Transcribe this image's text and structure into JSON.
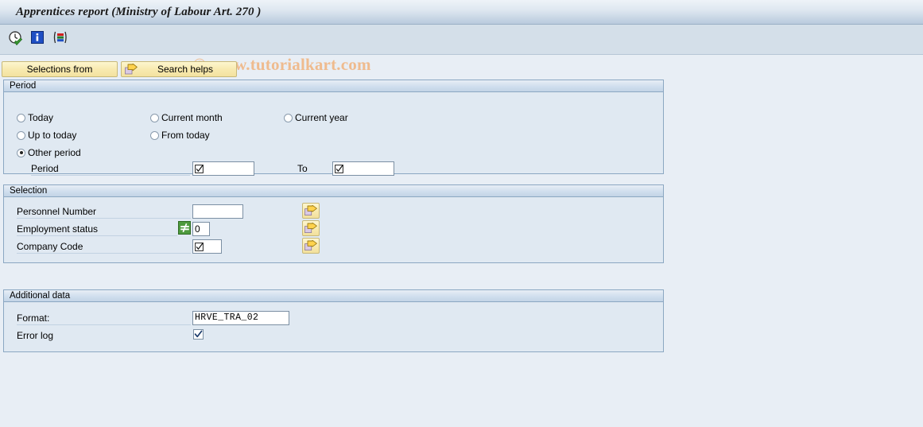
{
  "window": {
    "title": "Apprentices report (Ministry of Labour Art. 270 )"
  },
  "toolbar": {
    "icons": [
      {
        "name": "execute-clock-icon",
        "title": "Execute"
      },
      {
        "name": "information-icon",
        "title": "Information"
      },
      {
        "name": "variant-icon",
        "title": "Get variant"
      }
    ],
    "watermark": "© www.tutorialkart.com"
  },
  "tabs": [
    {
      "label": "Selections from",
      "icon": ""
    },
    {
      "label": "Search helps",
      "icon": "search-help-arrow-icon"
    }
  ],
  "period": {
    "header": "Period",
    "options": [
      {
        "label": "Today",
        "selected": false
      },
      {
        "label": "Current month",
        "selected": false
      },
      {
        "label": "Current year",
        "selected": false
      },
      {
        "label": "Up to today",
        "selected": false
      },
      {
        "label": "From today",
        "selected": false
      },
      {
        "label": "Other period",
        "selected": true
      }
    ],
    "from_label": "Period",
    "from_value": "",
    "to_label": "To",
    "to_value": ""
  },
  "selection": {
    "header": "Selection",
    "rows": [
      {
        "label": "Personnel Number",
        "value": "",
        "operator": "",
        "has_operator": false,
        "has_check_glyph": false,
        "arrow_button": "multiple-selection-button"
      },
      {
        "label": "Employment status",
        "value": "0",
        "operator": "≠",
        "has_operator": true,
        "has_check_glyph": false,
        "arrow_button": "multiple-selection-button"
      },
      {
        "label": "Company Code",
        "value": "",
        "operator": "",
        "has_operator": false,
        "has_check_glyph": true,
        "arrow_button": "multiple-selection-button"
      }
    ]
  },
  "additional": {
    "header": "Additional data",
    "format_label": "Format:",
    "format_value": "HRVE_TRA_02",
    "error_log_label": "Error log",
    "error_log_checked": true
  },
  "colors": {
    "page_bg": "#e8eef5",
    "panel_bg": "#e0e9f2",
    "panel_border": "#8ba7c2",
    "toolbar_bg": "#d4dfe9",
    "tab_yellow": "#f8eab0",
    "operator_green": "#4e9a3e",
    "watermark": "#efbb8e"
  }
}
